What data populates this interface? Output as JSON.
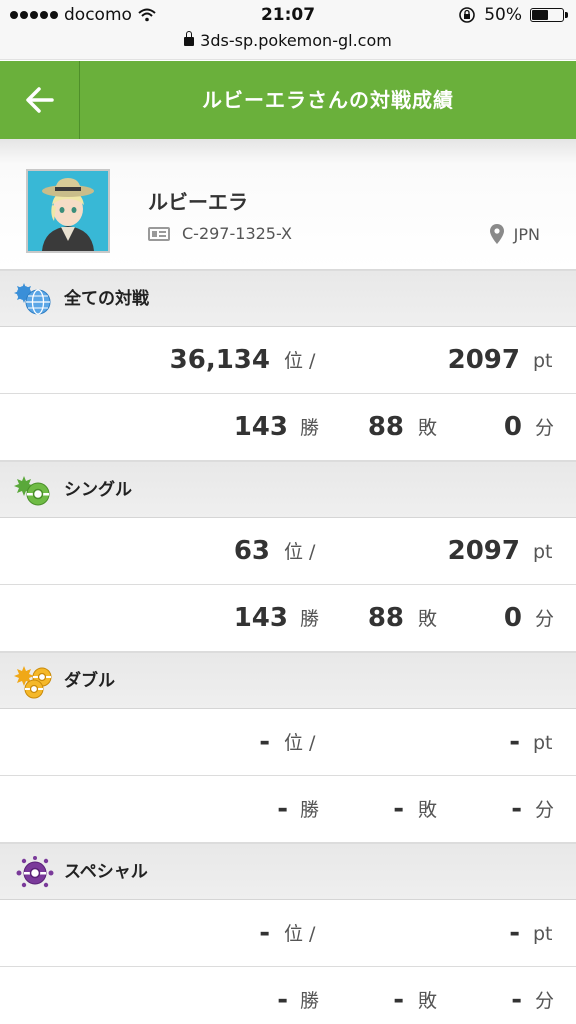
{
  "status_bar": {
    "carrier": "docomo",
    "time": "21:07",
    "battery": "50%",
    "battery_level": 0.5,
    "url": "3ds-sp.pokemon-gl.com"
  },
  "header": {
    "title": "ルビーエラさんの対戦成績"
  },
  "profile": {
    "name": "ルビーエラ",
    "player_id": "C-297-1325-X",
    "country": "JPN"
  },
  "units": {
    "rank": "位 /",
    "pt": "pt",
    "win": "勝",
    "loss": "敗",
    "draw": "分"
  },
  "sections": [
    {
      "title": "全ての対戦",
      "icon": "globe-battle-icon",
      "rank": "36,134",
      "points": "2097",
      "wins": "143",
      "losses": "88",
      "draws": "0"
    },
    {
      "title": "シングル",
      "icon": "single-battle-icon",
      "rank": "63",
      "points": "2097",
      "wins": "143",
      "losses": "88",
      "draws": "0"
    },
    {
      "title": "ダブル",
      "icon": "double-battle-icon",
      "rank": "-",
      "points": "-",
      "wins": "-",
      "losses": "-",
      "draws": "-"
    },
    {
      "title": "スペシャル",
      "icon": "special-battle-icon",
      "rank": "-",
      "points": "-",
      "wins": "-",
      "losses": "-",
      "draws": "-"
    }
  ],
  "colors": {
    "header_green": "#6ab03b",
    "single_green": "#5aa83a",
    "double_orange": "#f0a818",
    "special_purple": "#7a3a9a",
    "globe_blue": "#3a8fd8"
  }
}
